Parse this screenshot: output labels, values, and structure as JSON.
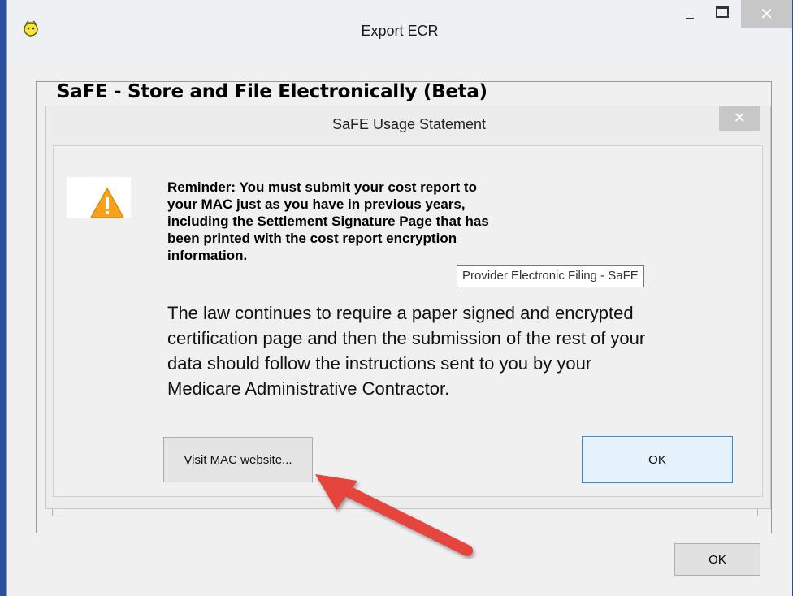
{
  "window": {
    "title": "Export ECR",
    "minimize_glyph": "",
    "close_glyph": "✕"
  },
  "group": {
    "title": "SaFE - Store and File Electronically (Beta)"
  },
  "dialog": {
    "title": "SaFE Usage Statement",
    "close_glyph": "✕",
    "reminder_lines": [
      "Reminder: You must submit your cost report to",
      "your MAC just as you have in previous years,",
      "including the Settlement Signature Page that has",
      "been printed with the cost report encryption",
      "information."
    ],
    "tooltip": "Provider Electronic Filing  - SaFE",
    "law_lines": [
      "The law continues to require a paper signed and encrypted",
      "certification page and then the submission of the rest of your",
      "data should follow the instructions sent to you by your",
      "Medicare Administrative Contractor."
    ],
    "visit_button_label": "Visit MAC website...",
    "ok_button_label": "OK"
  },
  "outer_ok_label": "OK",
  "colors": {
    "desktop": "#2b4f9e",
    "window_bg": "#f0f0f0",
    "warning_fill": "#f7a21b",
    "arrow": "#e5453c",
    "ok_border": "#3c8bd9"
  },
  "icons": {
    "app": "app-icon",
    "warning": "warning-icon",
    "arrow": "arrow-annotation"
  }
}
